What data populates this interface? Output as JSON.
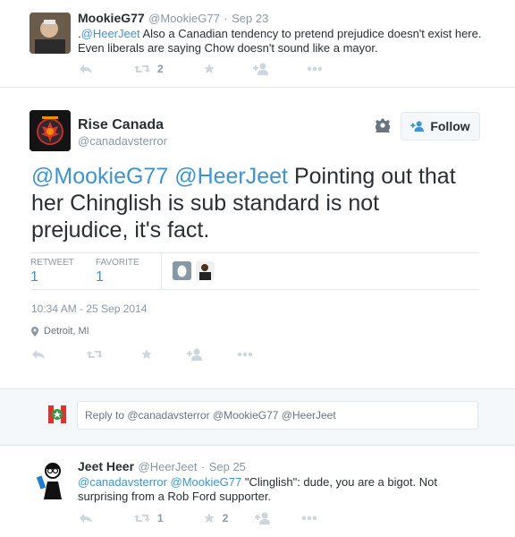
{
  "tweet1": {
    "name": "MookieG77",
    "handle": "@MookieG77",
    "dot": "·",
    "date": "Sep 23",
    "text_prefix": ".",
    "mention": "@HeerJeet",
    "text_rest": " Also a Canadian tendency to pretend prejudice doesn't exist here.",
    "text_line2": "Even liberals are saying Chow doesn't sound like a mayor.",
    "retweet_count": "2"
  },
  "main": {
    "name": "Rise Canada",
    "handle": "@canadavsterror",
    "follow_label": "Follow",
    "mention1": "@MookieG77",
    "mention2": "@HeerJeet",
    "text_line1_rest": " Pointing out that",
    "text_line2": "her Chinglish is sub standard is not",
    "text_line3": "prejudice, it's fact.",
    "stats": {
      "retweet_label": "RETWEET",
      "retweet_value": "1",
      "favorite_label": "FAVORITE",
      "favorite_value": "1"
    },
    "timestamp": "10:34 AM - 25 Sep 2014",
    "location": "Detroit, MI"
  },
  "reply": {
    "placeholder": "Reply to @canadavsterror @MookieG77 @HeerJeet"
  },
  "tweet3": {
    "name": "Jeet Heer",
    "handle": "@HeerJeet",
    "dot": "·",
    "date": "Sep 25",
    "mention1": "@canadavsterror",
    "mention2": "@MookieG77",
    "text_rest": " \"Clinglish\": dude, you are a bigot. Not",
    "text_line2": "surprising from a Rob Ford supporter.",
    "retweet_count": "1",
    "favorite_count": "2"
  },
  "colors": {
    "link": "#3b94d9",
    "reply_bg": "#f5f8fa",
    "border": "#e1e8ed",
    "action_icon": "#ccd6dd"
  }
}
